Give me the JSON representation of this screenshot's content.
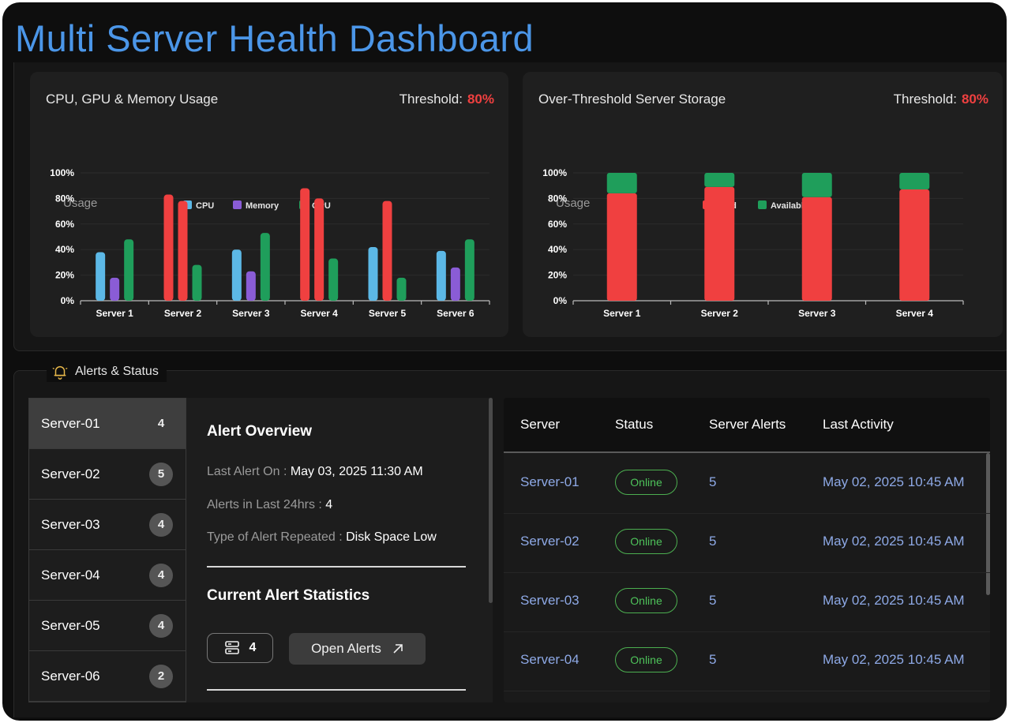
{
  "title": "Multi Server Health Dashboard",
  "cpu_card": {
    "title": "CPU, GPU & Memory Usage",
    "threshold_label": "Threshold:",
    "threshold_value": "80%"
  },
  "storage_card": {
    "title": "Over-Threshold Server Storage",
    "threshold_label": "Threshold:",
    "threshold_value": "80%"
  },
  "chart_data": [
    {
      "type": "bar",
      "ylabel": "Usage",
      "ylim": [
        0,
        100
      ],
      "yticks": [
        "0%",
        "20%",
        "40%",
        "60%",
        "80%",
        "100%"
      ],
      "categories": [
        "Server 1",
        "Server 2",
        "Server 3",
        "Server 4",
        "Server 5",
        "Server 6"
      ],
      "legend_position": "top",
      "threshold": 80,
      "series": [
        {
          "name": "CPU",
          "color": "#5cb8e6",
          "values": [
            38,
            83,
            40,
            88,
            42,
            39
          ]
        },
        {
          "name": "Memory",
          "color": "#8a5cd6",
          "values": [
            18,
            78,
            23,
            80,
            78,
            26
          ]
        },
        {
          "name": "GPU",
          "color": "#1f9e5b",
          "values": [
            48,
            28,
            53,
            33,
            18,
            48
          ]
        }
      ],
      "over_threshold_color": "#f04040"
    },
    {
      "type": "bar",
      "stacked": true,
      "ylabel": "Usage",
      "ylim": [
        0,
        100
      ],
      "yticks": [
        "0%",
        "20%",
        "40%",
        "60%",
        "80%",
        "100%"
      ],
      "categories": [
        "Server 1",
        "Server 2",
        "Server 3",
        "Server 4"
      ],
      "legend_position": "top",
      "series": [
        {
          "name": "Used",
          "color": "#f04040",
          "values": [
            84,
            89,
            81,
            87
          ]
        },
        {
          "name": "Available",
          "color": "#1f9e5b",
          "values": [
            16,
            11,
            19,
            13
          ]
        }
      ]
    }
  ],
  "alerts_section": {
    "title": "Alerts & Status",
    "icon": "bell-icon",
    "servers": [
      {
        "name": "Server-01",
        "count": "4"
      },
      {
        "name": "Server-02",
        "count": "5"
      },
      {
        "name": "Server-03",
        "count": "4"
      },
      {
        "name": "Server-04",
        "count": "4"
      },
      {
        "name": "Server-05",
        "count": "4"
      },
      {
        "name": "Server-06",
        "count": "2"
      }
    ],
    "overview": {
      "heading": "Alert Overview",
      "last_alert_label": "Last Alert On : ",
      "last_alert_value": "May 03, 2025 11:30 AM",
      "alerts_24h_label": "Alerts in Last 24hrs : ",
      "alerts_24h_value": "4",
      "repeated_label": "Type of Alert Repeated : ",
      "repeated_value": "Disk Space Low",
      "stats_heading": "Current Alert Statistics",
      "stats_count": "4",
      "open_alerts_label": "Open Alerts"
    },
    "table": {
      "headers": [
        "Server",
        "Status",
        "Server Alerts",
        "Last Activity"
      ],
      "rows": [
        {
          "server": "Server-01",
          "status": "Online",
          "alerts": "5",
          "activity": "May 02, 2025 10:45 AM"
        },
        {
          "server": "Server-02",
          "status": "Online",
          "alerts": "5",
          "activity": "May 02, 2025 10:45 AM"
        },
        {
          "server": "Server-03",
          "status": "Online",
          "alerts": "5",
          "activity": "May 02, 2025 10:45 AM"
        },
        {
          "server": "Server-04",
          "status": "Online",
          "alerts": "5",
          "activity": "May 02, 2025 10:45 AM"
        }
      ]
    }
  }
}
